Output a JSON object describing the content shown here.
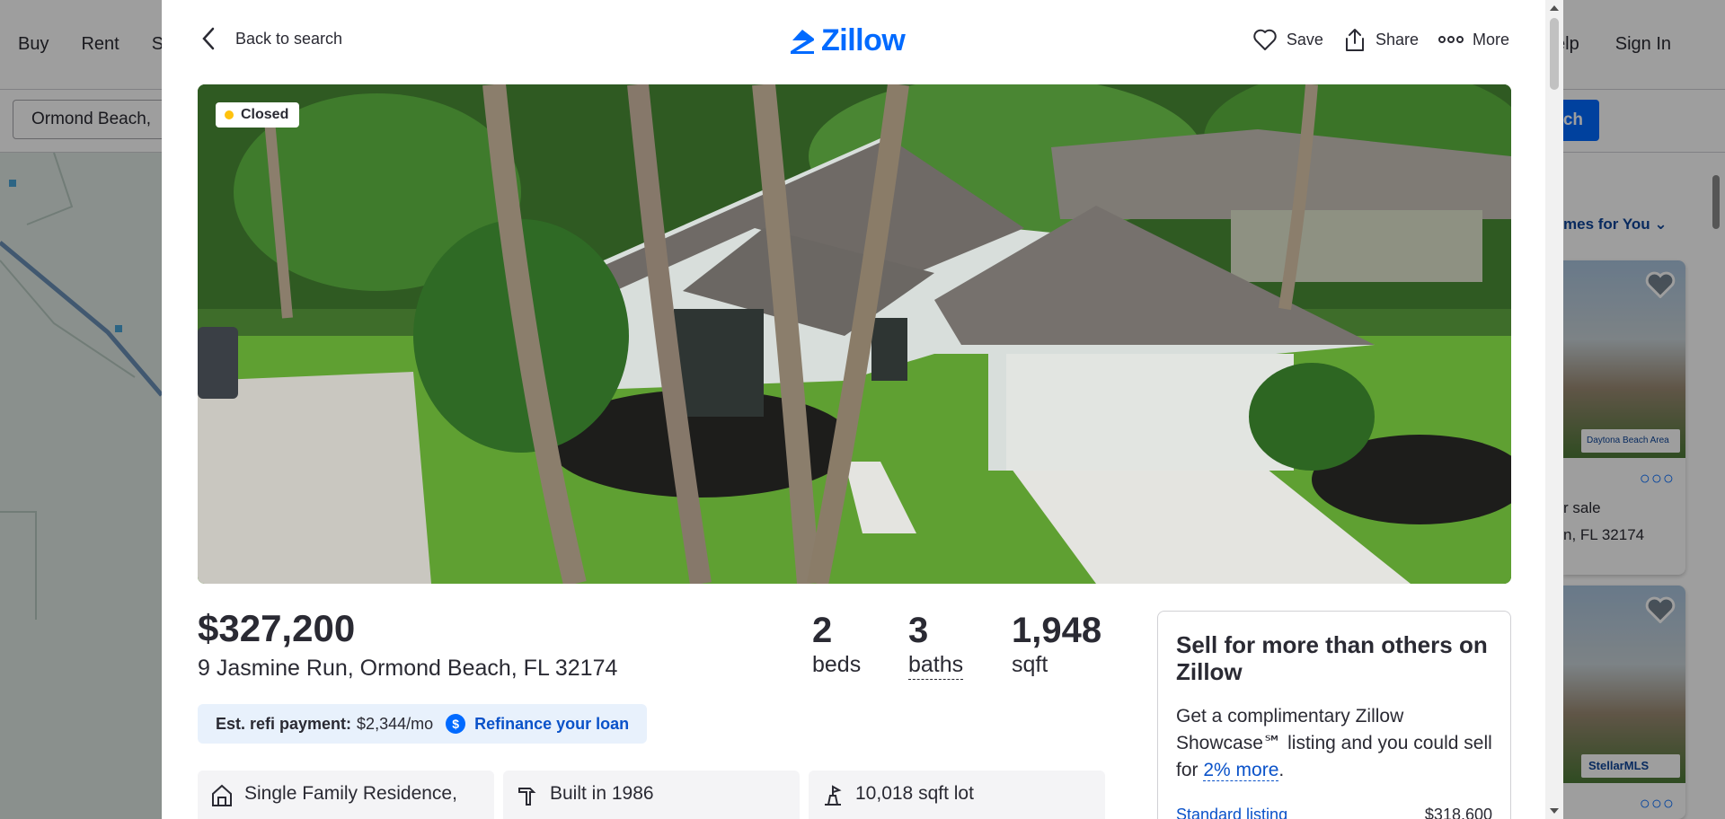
{
  "background": {
    "nav_left": [
      "Buy",
      "Rent",
      "S"
    ],
    "nav_right": [
      "Help",
      "Sign In"
    ],
    "search_value": "Ormond Beach,",
    "search_button": "rch",
    "sort_label": "mes for You",
    "card1_line1": "r sale",
    "card1_line2": "n, FL 32174",
    "card1_mls": "Daytona Beach Area",
    "card2_mls": "StellarMLS"
  },
  "topbar": {
    "back_label": "Back to search",
    "logo_text": "Zillow",
    "save_label": "Save",
    "share_label": "Share",
    "more_label": "More"
  },
  "photo": {
    "status_badge": "Closed"
  },
  "listing": {
    "price": "$327,200",
    "address": "9 Jasmine Run, Ormond Beach, FL 32174",
    "beds": "2",
    "beds_label": "beds",
    "baths": "3",
    "baths_label": "baths",
    "sqft": "1,948",
    "sqft_label": "sqft"
  },
  "refi": {
    "label": "Est. refi payment:",
    "value": "$2,344/mo",
    "icon_glyph": "$",
    "link": "Refinance your loan"
  },
  "facts": [
    {
      "text": "Single Family Residence,",
      "icon": "house-icon"
    },
    {
      "text": "Built in 1986",
      "icon": "hammer-icon"
    },
    {
      "text": "10,018 sqft lot",
      "icon": "lot-icon"
    }
  ],
  "sell_card": {
    "title": "Sell for more than others on Zillow",
    "body_before": "Get a complimentary Zillow Showcase℠ listing and you could sell for ",
    "body_link": "2% more",
    "body_after": ".",
    "row_label": "Standard listing",
    "row_value": "$318,600"
  },
  "colors": {
    "brand_blue": "#006aff",
    "link_blue": "#0a52c9",
    "text": "#2a2a33",
    "refi_bg": "#e8f1fc",
    "closed_dot": "#ffc20e"
  }
}
